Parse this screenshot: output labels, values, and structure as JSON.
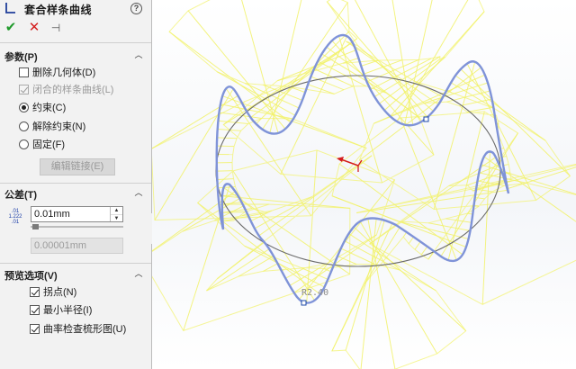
{
  "panel": {
    "title": "套合样条曲线",
    "help_icon": "?",
    "actions": {
      "ok": "✔",
      "cancel": "✕",
      "pin": "⊣"
    },
    "groups": {
      "params": {
        "title": "参数(P)"
      },
      "tolerance": {
        "title": "公差(T)"
      },
      "preview": {
        "title": "预览选项(V)"
      }
    },
    "params": {
      "delete_geometry": {
        "label": "删除几何体(D)",
        "checked": false
      },
      "closed_spline": {
        "label": "闭合的样条曲线(L)",
        "checked": true,
        "disabled": true
      },
      "constrained": {
        "label": "约束(C)",
        "selected": true
      },
      "unconstrained": {
        "label": "解除约束(N)",
        "selected": false
      },
      "fixed": {
        "label": "固定(F)",
        "selected": false
      },
      "edit_link_button": "编辑链接(E)"
    },
    "tolerance": {
      "icon_text_top": ".01",
      "icon_text_mid": "1.222",
      "icon_text_bot": ".01",
      "value": "0.01mm",
      "min_value": "0.00001mm"
    },
    "preview": {
      "inflection": {
        "label": "拐点(N)",
        "checked": true
      },
      "min_radius": {
        "label": "最小半径(I)",
        "checked": true
      },
      "curvature_comb": {
        "label": "曲率检查梳形图(U)",
        "checked": true
      }
    }
  },
  "graphics": {
    "radius_annotation": "R2.40",
    "colors": {
      "spline": "#7f93d8",
      "comb": "#f2f26a",
      "circle": "#6a6a6a",
      "origin": "#d41c1c"
    }
  }
}
